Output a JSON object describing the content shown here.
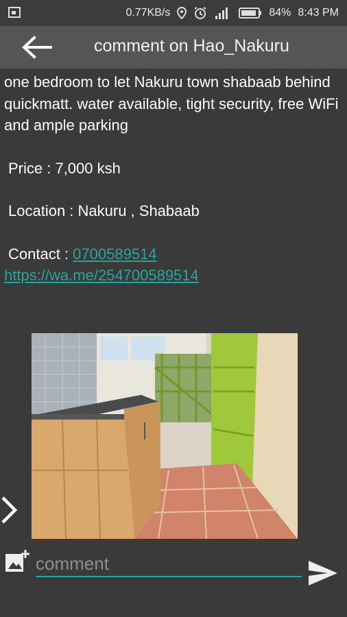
{
  "status_bar": {
    "speed": "0.77KB/s",
    "battery": "84%",
    "time": "8:43 PM",
    "icons": [
      "screenshot-icon",
      "location-icon",
      "alarm-icon",
      "lte-signal-icon",
      "battery-icon"
    ]
  },
  "app_bar": {
    "back_icon": "arrow-back-icon",
    "title": "comment on Hao_Nakuru"
  },
  "post": {
    "description": "one bedroom to let Nakuru town shabaab behind quickmatt. water available, tight security, free WiFi and ample parking",
    "price": "Price : 7,000 ksh",
    "location": "Location : Nakuru , Shabaab",
    "contact_label": "Contact : ",
    "contact_phone": "0700589514",
    "whatsapp_link": "https://wa.me/254700589514",
    "image_alt": "kitchen and balcony photo"
  },
  "nav": {
    "next_icon": "chevron-right-icon"
  },
  "composer": {
    "placeholder": "comment",
    "add_image_icon": "add-photo-icon",
    "send_icon": "send-icon"
  },
  "colors": {
    "accent": "#26a69a",
    "app_bar": "#555555",
    "background": "#3a3a3a"
  }
}
